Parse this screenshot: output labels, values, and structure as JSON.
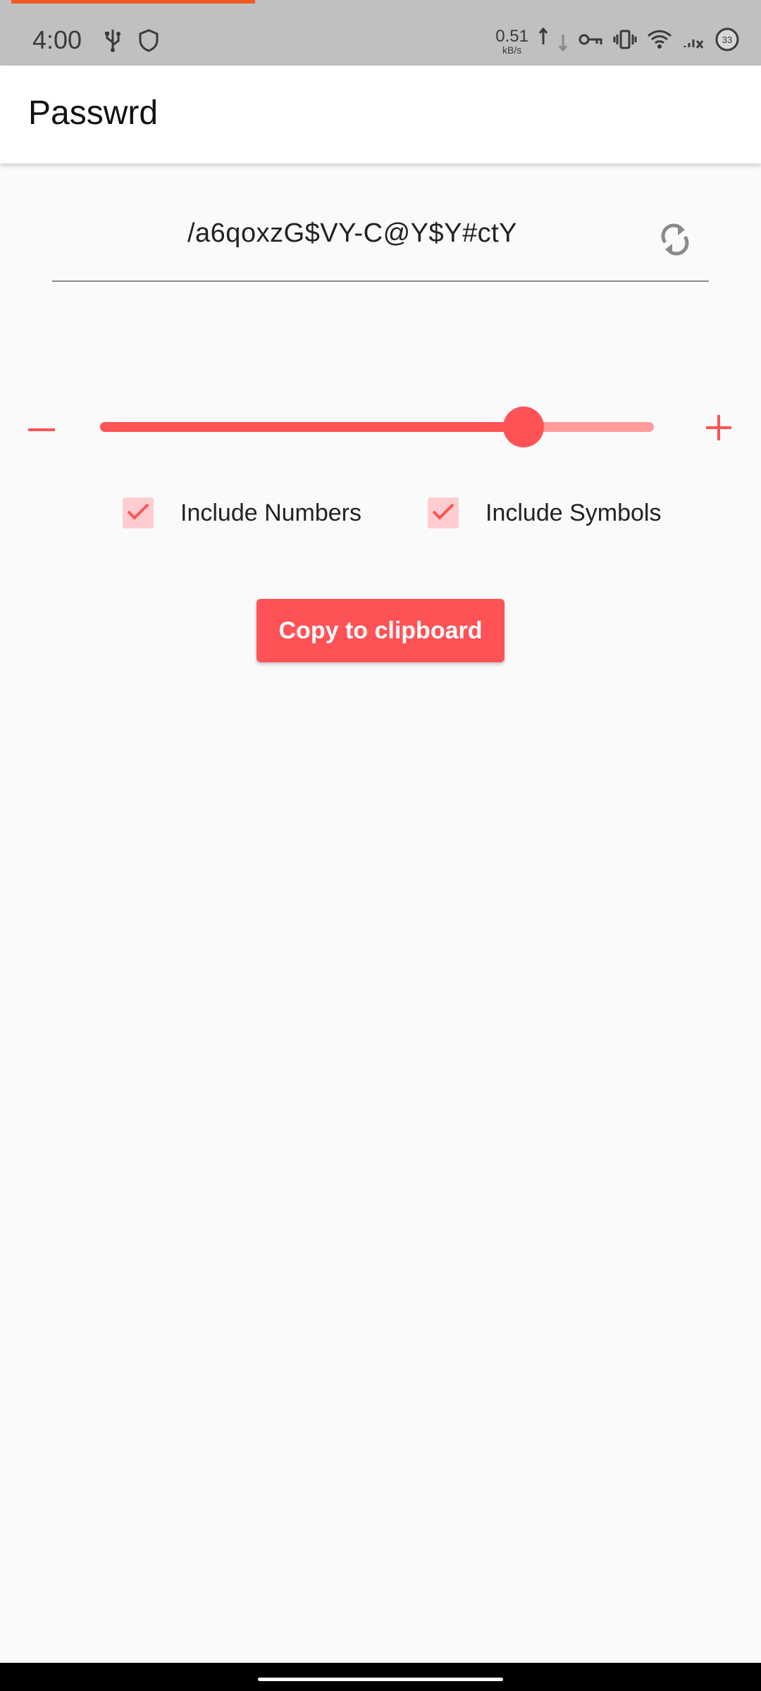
{
  "status_bar": {
    "time": "4:00",
    "net_speed_value": "0.51",
    "net_speed_unit": "kB/s",
    "battery_level": "33",
    "icons": [
      "usb-icon",
      "shield-icon",
      "upload-arrow-icon",
      "download-arrow-icon",
      "vpn-key-icon",
      "vibrate-icon",
      "wifi-icon",
      "signal-icon",
      "battery-icon"
    ]
  },
  "app_bar": {
    "title": "Passwrd"
  },
  "password": {
    "value": "/a6qoxzG$VY-C@Y$Y#ctY"
  },
  "length_slider": {
    "fraction": 0.765
  },
  "options": {
    "numbers": {
      "label": "Include Numbers",
      "checked": true
    },
    "symbols": {
      "label": "Include Symbols",
      "checked": true
    }
  },
  "copy_button": {
    "label": "Copy to clipboard"
  },
  "colors": {
    "accent": "#ff5257",
    "accent_light": "#ff9b9b",
    "checkbox_bg": "#ffcdd0",
    "status_progress": "#f05a23"
  }
}
